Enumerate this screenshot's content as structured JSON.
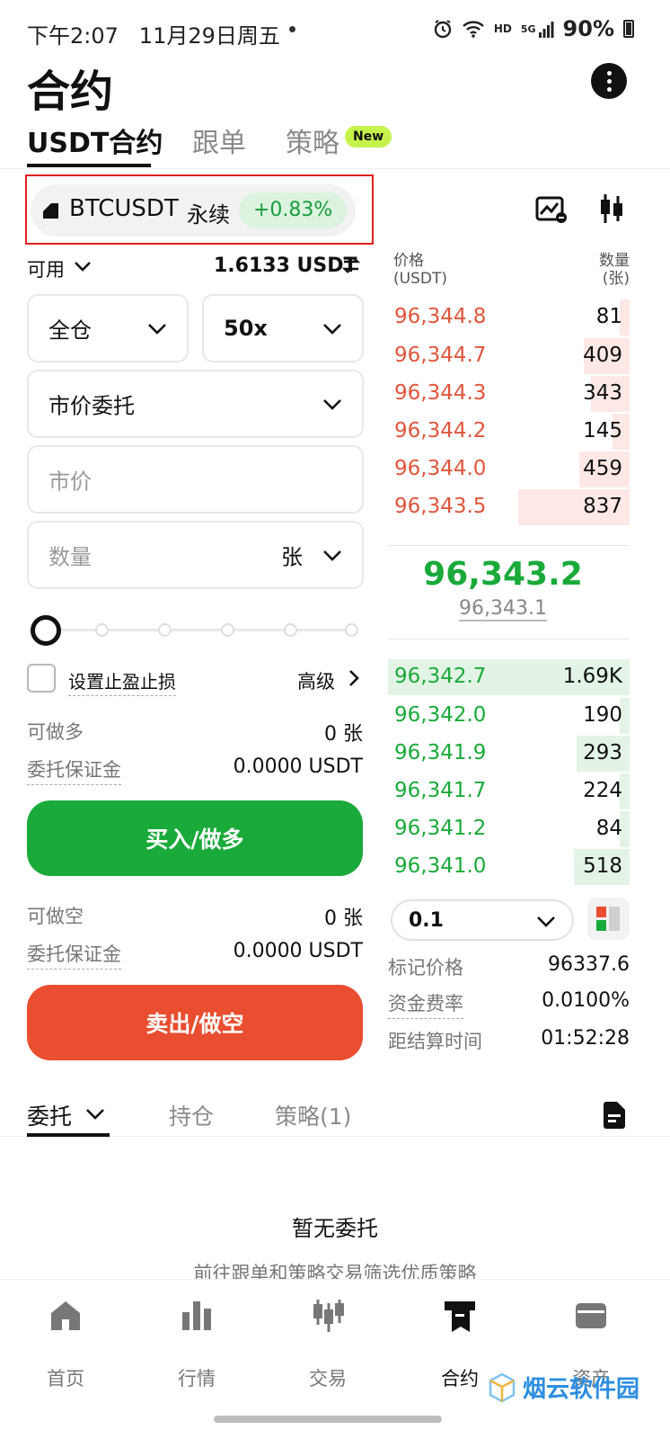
{
  "status_bar": {
    "time": "下午2:07",
    "date": "11月29日周五",
    "battery": "90%",
    "network_hd": "HD",
    "network_5g": "5G"
  },
  "header": {
    "title": "合约",
    "more_icon": "more-vertical-icon"
  },
  "top_tabs": [
    {
      "label": "USDT合约",
      "active": true
    },
    {
      "label": "跟单",
      "active": false
    },
    {
      "label": "策略",
      "active": false
    }
  ],
  "new_badge": "New",
  "symbol": {
    "name": "BTCUSDT",
    "type": "永续",
    "change": "+0.83%",
    "change_color": "#1aaa3a"
  },
  "trade_form": {
    "available_label": "可用",
    "available_value": "1.6133 USDT",
    "margin_mode": "全仓",
    "leverage": "50x",
    "order_type": "市价委托",
    "price_placeholder": "市价",
    "quantity_placeholder": "数量",
    "quantity_unit": "张",
    "slider_percent": 0,
    "tp_sl_label": "设置止盈止损",
    "advanced_label": "高级",
    "long_section": {
      "max_label": "可做多",
      "max_value": "0 张",
      "margin_label": "委托保证金",
      "margin_value": "0.0000 USDT"
    },
    "buy_button": "买入/做多",
    "short_section": {
      "max_label": "可做空",
      "max_value": "0 张",
      "margin_label": "委托保证金",
      "margin_value": "0.0000 USDT"
    },
    "sell_button": "卖出/做空"
  },
  "order_book": {
    "price_header_line1": "价格",
    "price_header_line2": "(USDT)",
    "qty_header_line1": "数量",
    "qty_header_line2": "(张)",
    "asks": [
      {
        "price": "96,344.8",
        "qty": "81",
        "depth": 0.04
      },
      {
        "price": "96,344.7",
        "qty": "409",
        "depth": 0.19
      },
      {
        "price": "96,344.3",
        "qty": "343",
        "depth": 0.16
      },
      {
        "price": "96,344.2",
        "qty": "145",
        "depth": 0.07
      },
      {
        "price": "96,344.0",
        "qty": "459",
        "depth": 0.21
      },
      {
        "price": "96,343.5",
        "qty": "837",
        "depth": 0.46
      }
    ],
    "last_price": "96,343.2",
    "mark_price": "96,343.1",
    "bids": [
      {
        "price": "96,342.7",
        "qty": "1.69K",
        "depth": 1.0
      },
      {
        "price": "96,342.0",
        "qty": "190",
        "depth": 0.04
      },
      {
        "price": "96,341.9",
        "qty": "293",
        "depth": 0.22
      },
      {
        "price": "96,341.7",
        "qty": "224",
        "depth": 0.04
      },
      {
        "price": "96,341.2",
        "qty": "84",
        "depth": 0.04
      },
      {
        "price": "96,341.0",
        "qty": "518",
        "depth": 0.23
      }
    ],
    "depth_step": "0.1",
    "ask_color": "#e0563c",
    "bid_color": "#1aaa3a"
  },
  "market_stats": [
    {
      "label": "标记价格",
      "value": "96337.6"
    },
    {
      "label": "资金费率",
      "value": "0.0100%"
    },
    {
      "label": "距结算时间",
      "value": "01:52:28"
    }
  ],
  "bottom_tabs": [
    {
      "label": "委托",
      "active": true
    },
    {
      "label": "持仓",
      "active": false
    },
    {
      "label": "策略(1)",
      "active": false
    }
  ],
  "empty_state": {
    "title": "暂无委托",
    "subtitle": "前往跟单和策略交易筛选优质策略"
  },
  "bottom_nav": [
    {
      "label": "首页",
      "icon": "home-icon"
    },
    {
      "label": "行情",
      "icon": "bar-chart-icon"
    },
    {
      "label": "交易",
      "icon": "candles-icon"
    },
    {
      "label": "合约",
      "icon": "contract-icon",
      "active": true
    },
    {
      "label": "资产",
      "icon": "wallet-icon"
    }
  ],
  "watermark": "烟云软件园",
  "colors": {
    "buy": "#1aaa3a",
    "sell": "#e84e2f",
    "highlight_border": "#e02020",
    "new_badge": "#c6f24b"
  }
}
